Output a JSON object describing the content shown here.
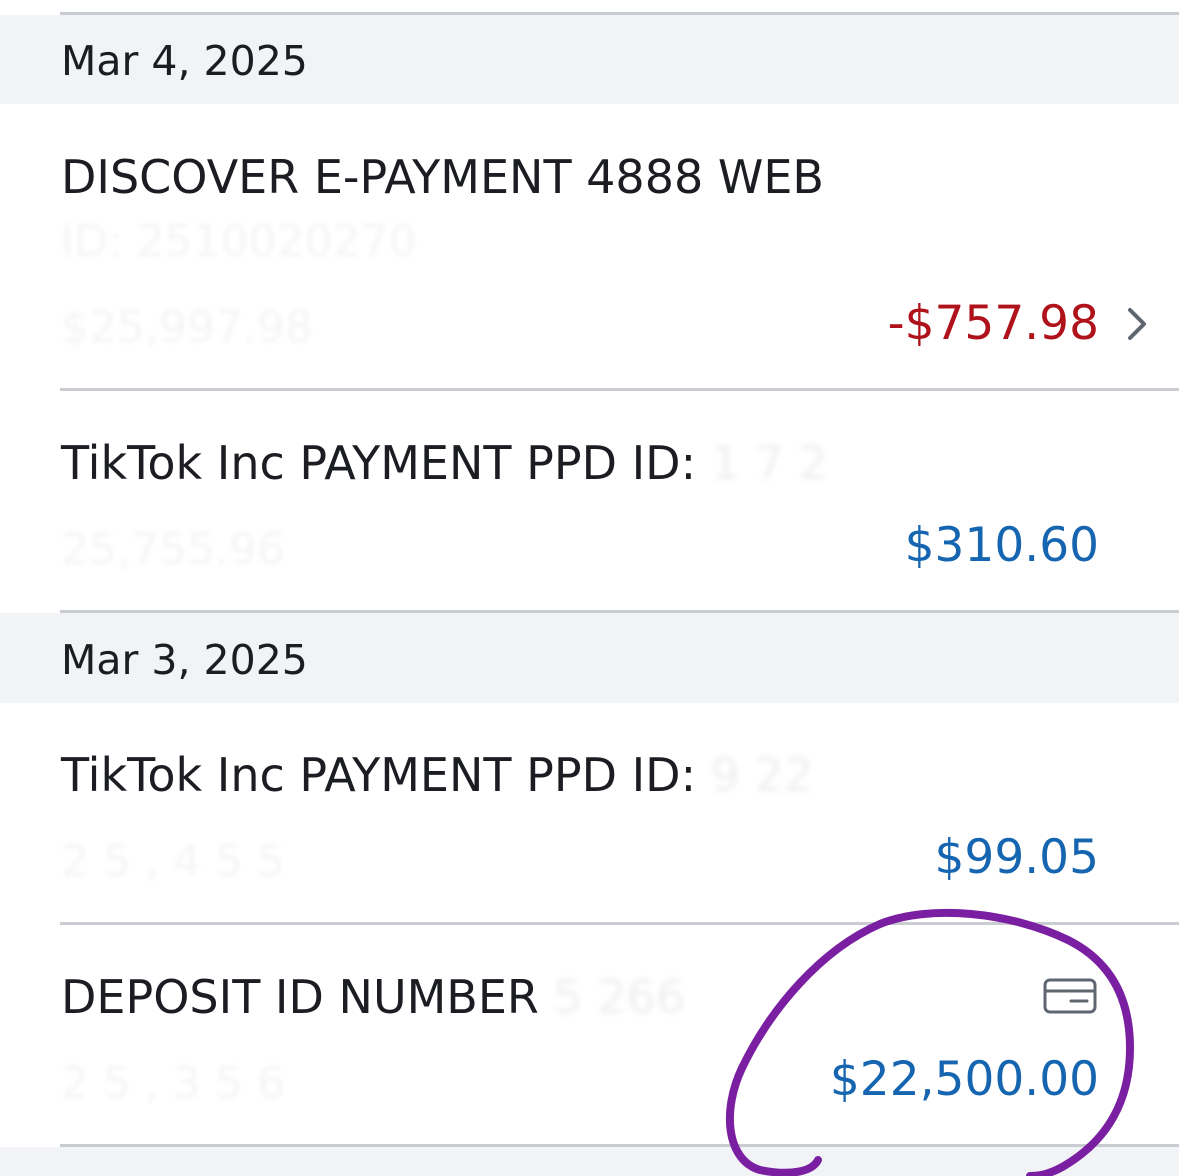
{
  "groups": [
    {
      "date": "Mar 4, 2025",
      "transactions": [
        {
          "title": "DISCOVER E-PAYMENT 4888 WEB",
          "id_line": "ID: 2510020270",
          "balance": "$25,997.98",
          "amount": "-$757.98",
          "type": "debit"
        },
        {
          "title": "TikTok Inc PAYMENT PPD ID:",
          "title_masked": " 1     7   2",
          "balance": "25,755.96",
          "amount": "$310.60",
          "type": "credit"
        }
      ]
    },
    {
      "date": "Mar 3, 2025",
      "transactions": [
        {
          "title": "TikTok Inc PAYMENT PPD ID:",
          "title_masked": " 9        22",
          "balance": "2 5 , 4 5 5",
          "amount": "$99.05",
          "type": "credit"
        },
        {
          "title": "DEPOSIT ID NUMBER",
          "title_masked": " 5   266",
          "balance": "2 5 , 3 5 6",
          "amount": "$22,500.00",
          "type": "credit"
        }
      ]
    }
  ],
  "icons": {
    "row_chevron": "chevron-right-icon",
    "deposit_card": "card-icon"
  },
  "colors": {
    "debit": "#b0121b",
    "credit": "#1565b0",
    "header_bg": "#f2f3f6",
    "annotation_circle": "#7a1fa2"
  }
}
